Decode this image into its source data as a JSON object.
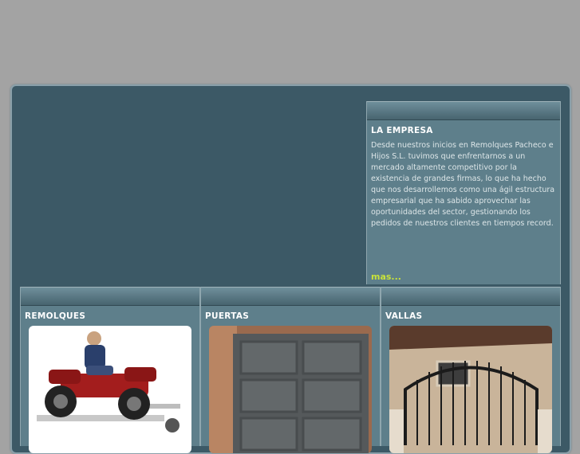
{
  "empresa": {
    "title": "LA EMPRESA",
    "text": "Desde nuestros inicios en  Remolques Pacheco e Hijos S.L. tuvimos que enfrentarnos a un mercado altamente competitivo por la existencia de grandes firmas, lo que ha hecho que nos desarrollemos como una ágil estructura empresarial que ha sabido aprovechar las oportunidades del sector, gestionando los pedidos de nuestros clientes en tiempos record.",
    "more_link": "mas..."
  },
  "products": [
    {
      "title": "REMOLQUES",
      "image": "quad-on-trailer"
    },
    {
      "title": "PUERTAS",
      "image": "garage-door"
    },
    {
      "title": "VALLAS",
      "image": "iron-gate"
    }
  ],
  "colors": {
    "page_bg": "#a3a3a3",
    "frame_bg": "#3c5966",
    "panel_bg": "#5e7f8b",
    "link": "#c8e23a"
  }
}
